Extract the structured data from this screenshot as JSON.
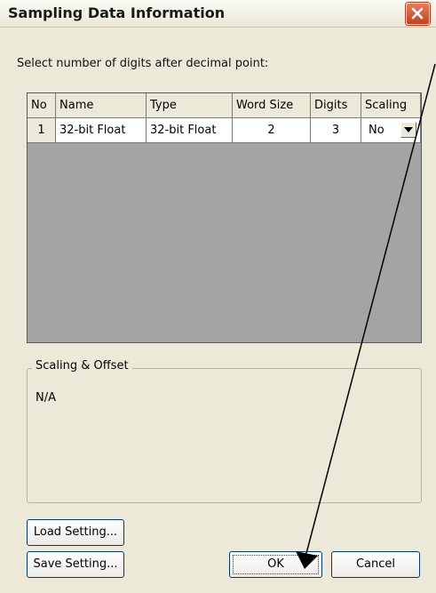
{
  "window": {
    "title": "Sampling Data Information",
    "close_icon": "close-icon"
  },
  "prompt": "Select number of digits after decimal point:",
  "table": {
    "columns": [
      "No",
      "Name",
      "Type",
      "Word Size",
      "Digits",
      "Scaling"
    ],
    "rows": [
      {
        "no": "1",
        "name": "32-bit Float",
        "type": "32-bit Float",
        "word_size": "2",
        "digits": "3",
        "scaling": "No"
      }
    ]
  },
  "scaling_offset": {
    "legend": "Scaling & Offset",
    "value": "N/A"
  },
  "buttons": {
    "load": "Load Setting...",
    "save": "Save Setting...",
    "ok": "OK",
    "cancel": "Cancel"
  },
  "colors": {
    "dialog_bg": "#ece9d8",
    "close_red": "#c4401f",
    "grid_bg": "#a4a4a4"
  }
}
